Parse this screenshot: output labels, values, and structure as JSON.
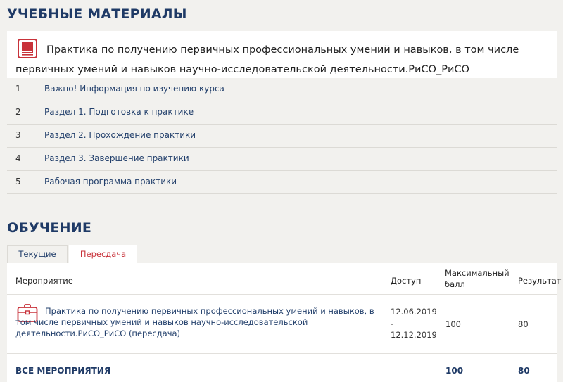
{
  "materials": {
    "title": "УЧЕБНЫЕ МАТЕРИАЛЫ",
    "course_title": "Практика по получению первичных профессиональных умений и навыков, в том числе первичных умений и навыков научно-исследовательской деятельности.РиСО_РиСО",
    "course_icon": "book-icon",
    "topics": [
      {
        "num": "1",
        "label": "Важно! Информация по изучению курса"
      },
      {
        "num": "2",
        "label": "Раздел 1. Подготовка к практике"
      },
      {
        "num": "3",
        "label": "Раздел 2. Прохождение практики"
      },
      {
        "num": "4",
        "label": "Раздел 3. Завершение практики"
      },
      {
        "num": "5",
        "label": "Рабочая программа практики"
      }
    ]
  },
  "learning": {
    "title": "ОБУЧЕНИЕ",
    "tabs": [
      {
        "label": "Текущие",
        "active": false
      },
      {
        "label": "Пересдача",
        "active": true
      }
    ],
    "table": {
      "headers": {
        "event": "Мероприятие",
        "access": "Доступ",
        "max_score_line1": "Максимальный",
        "max_score_line2": "балл",
        "result": "Результат"
      },
      "rows": [
        {
          "icon": "briefcase-icon",
          "event": "Практика по получению первичных профессиональных умений и навыков, в том числе первичных умений и навыков научно-исследовательской деятельности.РиСО_РиСО (пересдача)",
          "access_from": "12.06.2019",
          "access_sep": "-",
          "access_to": "12.12.2019",
          "max_score": "100",
          "result": "80"
        }
      ],
      "footer": {
        "label": "ВСЕ МЕРОПРИЯТИЯ",
        "max_score": "100",
        "result": "80"
      }
    }
  },
  "colors": {
    "accent_red": "#c8323a",
    "heading_blue": "#1f3a66",
    "link_blue": "#23406c"
  }
}
